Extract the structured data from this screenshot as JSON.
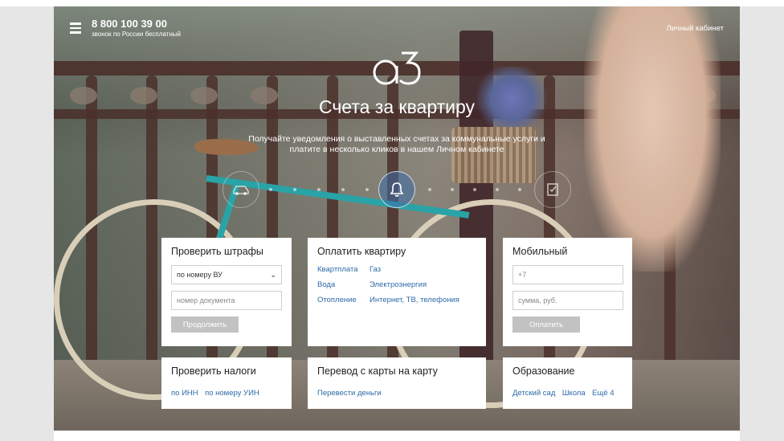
{
  "header": {
    "phone": "8 800 100 39 00",
    "phone_sub": "звонок по России бесплатный",
    "account": "Личный кабинет",
    "menu_icon": "hamburger-icon"
  },
  "hero": {
    "title": "Счета за квартиру",
    "subtitle_line1": "Получайте уведомления о выставленных счетах за коммунальные услуги и",
    "subtitle_line2": "платите в несколько кликов в нашем Личном кабинете",
    "icons": [
      "car-icon",
      "bell-icon",
      "checklist-icon"
    ],
    "active_icon": "bell-icon"
  },
  "cards": {
    "fines": {
      "title": "Проверить штрафы",
      "select_value": "по номеру ВУ",
      "input_placeholder": "номер документа",
      "button": "Продолжить"
    },
    "flat": {
      "title": "Оплатить квартиру",
      "links": [
        "Квартплата",
        "Газ",
        "Вода",
        "Электроэнергия",
        "Отопление",
        "Интернет, ТВ, телефония"
      ]
    },
    "mobile": {
      "title": "Мобильный",
      "phone_placeholder": "+7",
      "sum_placeholder": "сумма, руб.",
      "button": "Оплатить"
    },
    "taxes": {
      "title": "Проверить налоги",
      "links": [
        "по ИНН",
        "по номеру УИН"
      ]
    },
    "transfer": {
      "title": "Перевод с карты на карту",
      "links": [
        "Перевести деньги"
      ]
    },
    "education": {
      "title": "Образование",
      "links": [
        "Детский сад",
        "Школа",
        "Ещё 4"
      ]
    }
  },
  "colors": {
    "link": "#2c6aa8",
    "button_disabled": "#c2c2c2",
    "icon_active": "#3c6eaa"
  }
}
